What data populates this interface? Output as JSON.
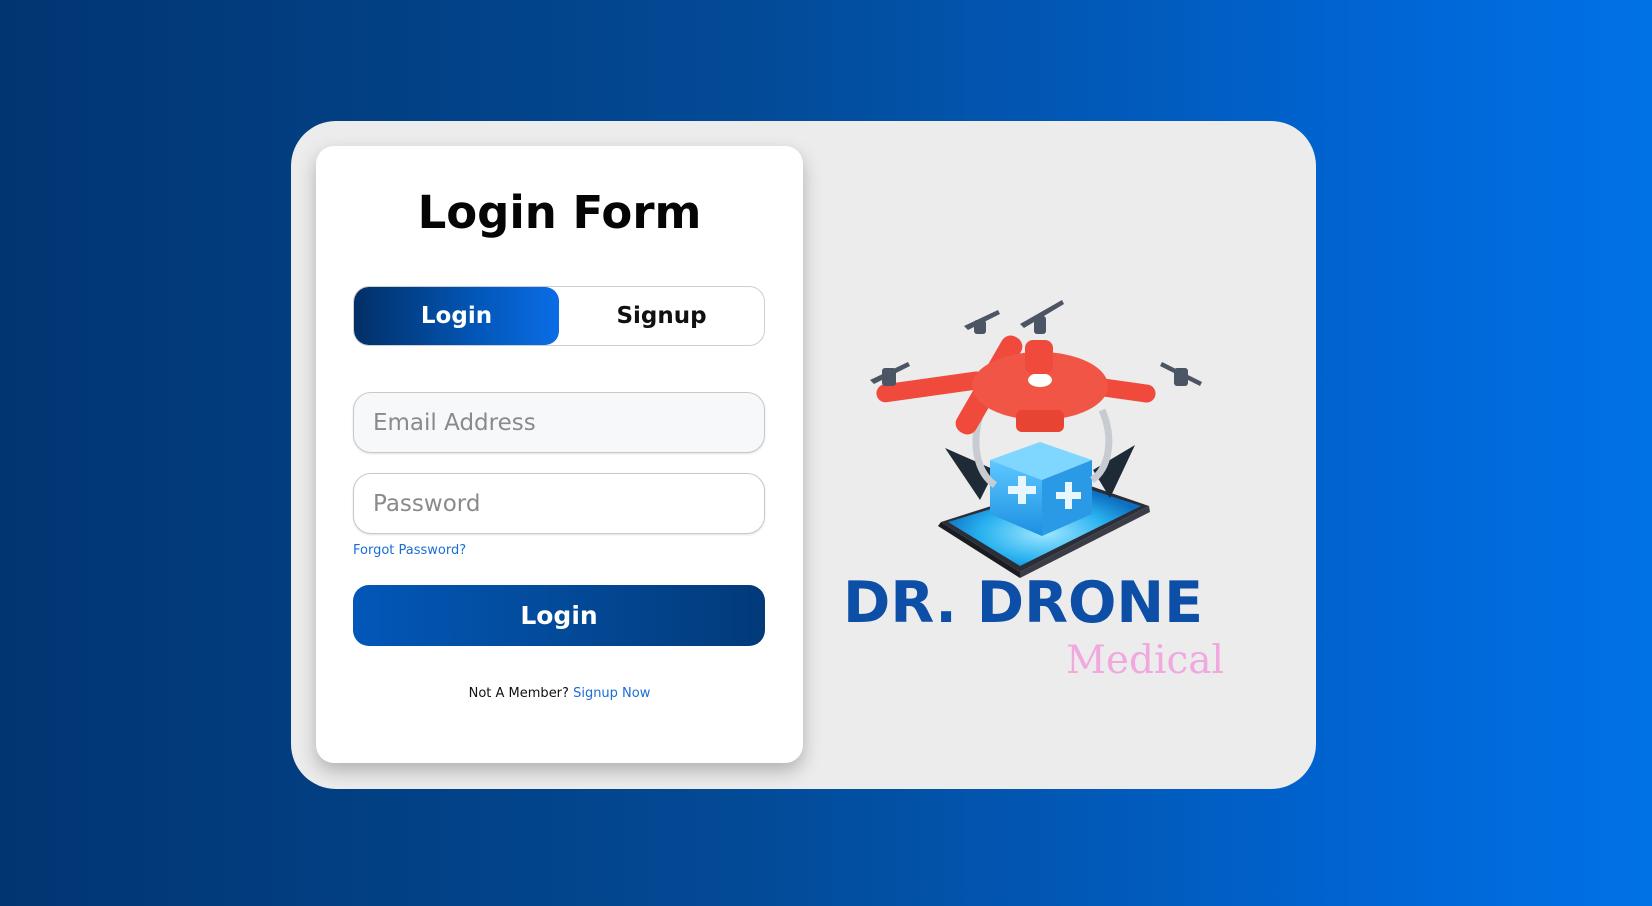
{
  "form": {
    "title": "Login Form",
    "tabs": [
      {
        "label": "Login",
        "active": true
      },
      {
        "label": "Signup",
        "active": false
      }
    ],
    "email_placeholder": "Email Address",
    "password_placeholder": "Password",
    "forgot_password": "Forgot Password?",
    "submit_label": "Login",
    "not_member_text": "Not A Member?",
    "signup_now_link": "Signup Now"
  },
  "brand": {
    "name": "DR. DRONE",
    "subtitle": "Medical",
    "logo_icon": "medical-drone-icon"
  },
  "colors": {
    "primary": "#034a99",
    "accent_link": "#1a6dd6",
    "brand_blue": "#0d4ea6",
    "brand_pink": "#f0a8df",
    "drone_red": "#ef4a3c"
  }
}
